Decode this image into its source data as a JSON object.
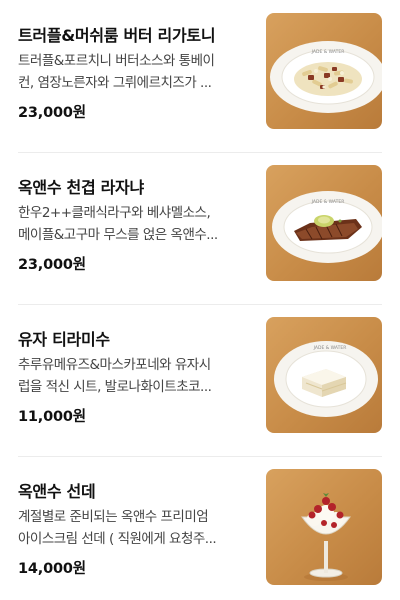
{
  "menu": {
    "items": [
      {
        "name": "트러플&머쉬룸 버터 리가토니",
        "desc_line1": "트러플&포르치니 버터소스와 통베이",
        "desc_line2": "컨, 염장노른자와 그뤼에르치즈가 ...",
        "price": "23,000원",
        "image_icon": "rigatoni-plate-image",
        "plate_text": "JADE & WATER"
      },
      {
        "name": "옥앤수 천겹 라자냐",
        "desc_line1": "한우2++클래식라구와 베샤멜소스,",
        "desc_line2": "메이플&고구마 무스를 얹은 옥앤수...",
        "price": "23,000원",
        "image_icon": "lasagna-plate-image",
        "plate_text": "JADE & WATER"
      },
      {
        "name": "유자 티라미수",
        "desc_line1": "추루유메유즈&마스카포네와 유자시",
        "desc_line2": "럽을 적신 시트, 발로나화이트초코...",
        "price": "11,000원",
        "image_icon": "tiramisu-plate-image",
        "plate_text": "JADE & WATER"
      },
      {
        "name": "옥앤수 선데",
        "desc_line1": "계절별로 준비되는 옥앤수 프리미엄",
        "desc_line2": "아이스크림 선데 ( 직원에게 요청주...",
        "price": "14,000원",
        "image_icon": "sundae-glass-image"
      }
    ]
  }
}
